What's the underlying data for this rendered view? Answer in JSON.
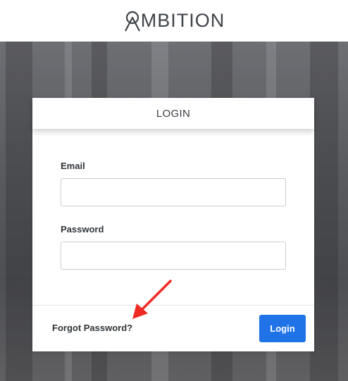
{
  "header": {
    "logo_text": "MBITION",
    "logo_initial_icon": "ambition-a-icon"
  },
  "login_card": {
    "title": "LOGIN",
    "email": {
      "label": "Email",
      "value": "",
      "placeholder": ""
    },
    "password": {
      "label": "Password",
      "value": "",
      "placeholder": ""
    },
    "forgot_password_label": "Forgot Password?",
    "login_button_label": "Login"
  },
  "annotation": {
    "icon": "red-arrow-icon",
    "color": "#ee2b23"
  },
  "colors": {
    "primary_button": "#1f73e6",
    "logo_text": "#3f4449"
  }
}
